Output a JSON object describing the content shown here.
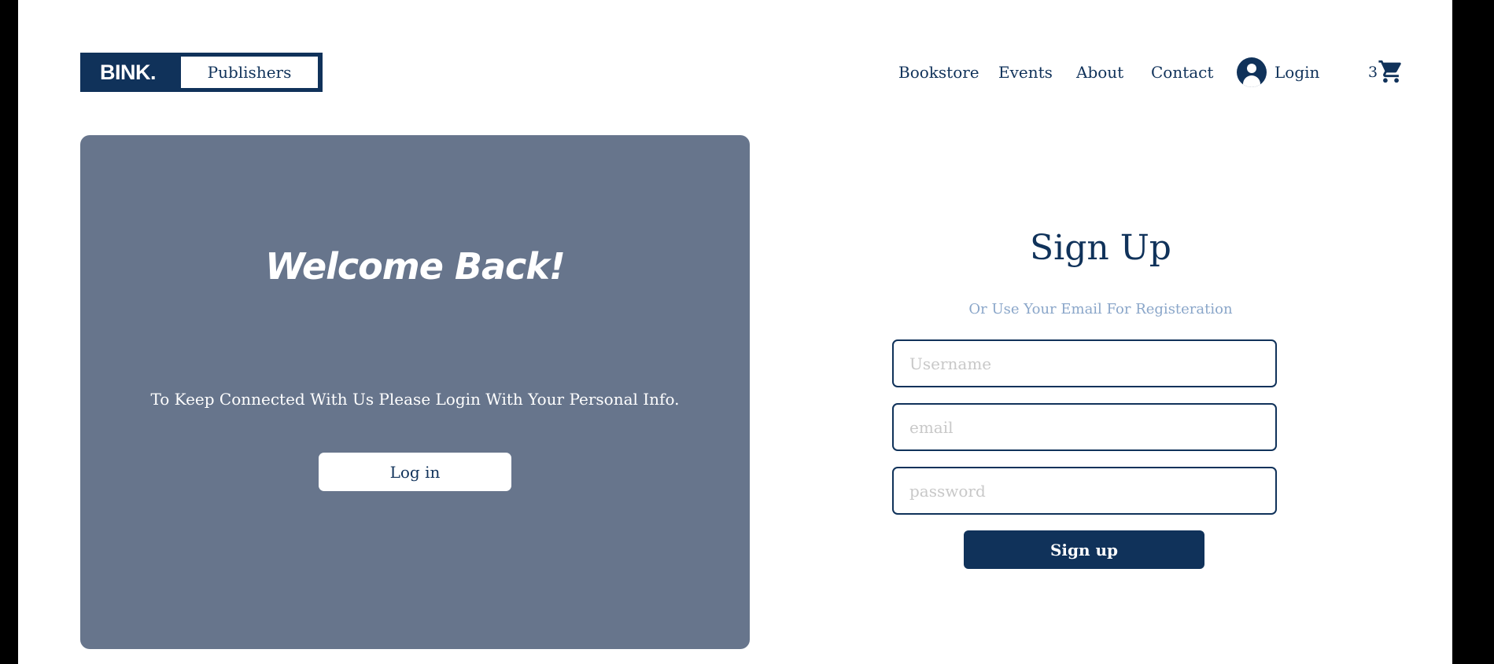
{
  "header": {
    "logo_brand": "BINK.",
    "logo_sub": "Publishers",
    "nav": [
      "Bookstore",
      "Events",
      "About",
      "Contact"
    ],
    "login_label": "Login",
    "cart_count": "3",
    "icons": {
      "login": "user-circle-icon",
      "cart": "shopping-cart-icon"
    }
  },
  "welcome_panel": {
    "title": "Welcome Back!",
    "text": "To Keep Connected With Us Please Login With Your Personal Info.",
    "button": "Log in"
  },
  "signup": {
    "title": "Sign Up",
    "subtitle": "Or Use Your Email For Registeration",
    "username_placeholder": "Username",
    "email_placeholder": "email",
    "password_placeholder": "password",
    "button": "Sign up"
  },
  "colors": {
    "brand": "#10325a",
    "panel": "#67758c",
    "subtitle": "#8aa6c9"
  }
}
